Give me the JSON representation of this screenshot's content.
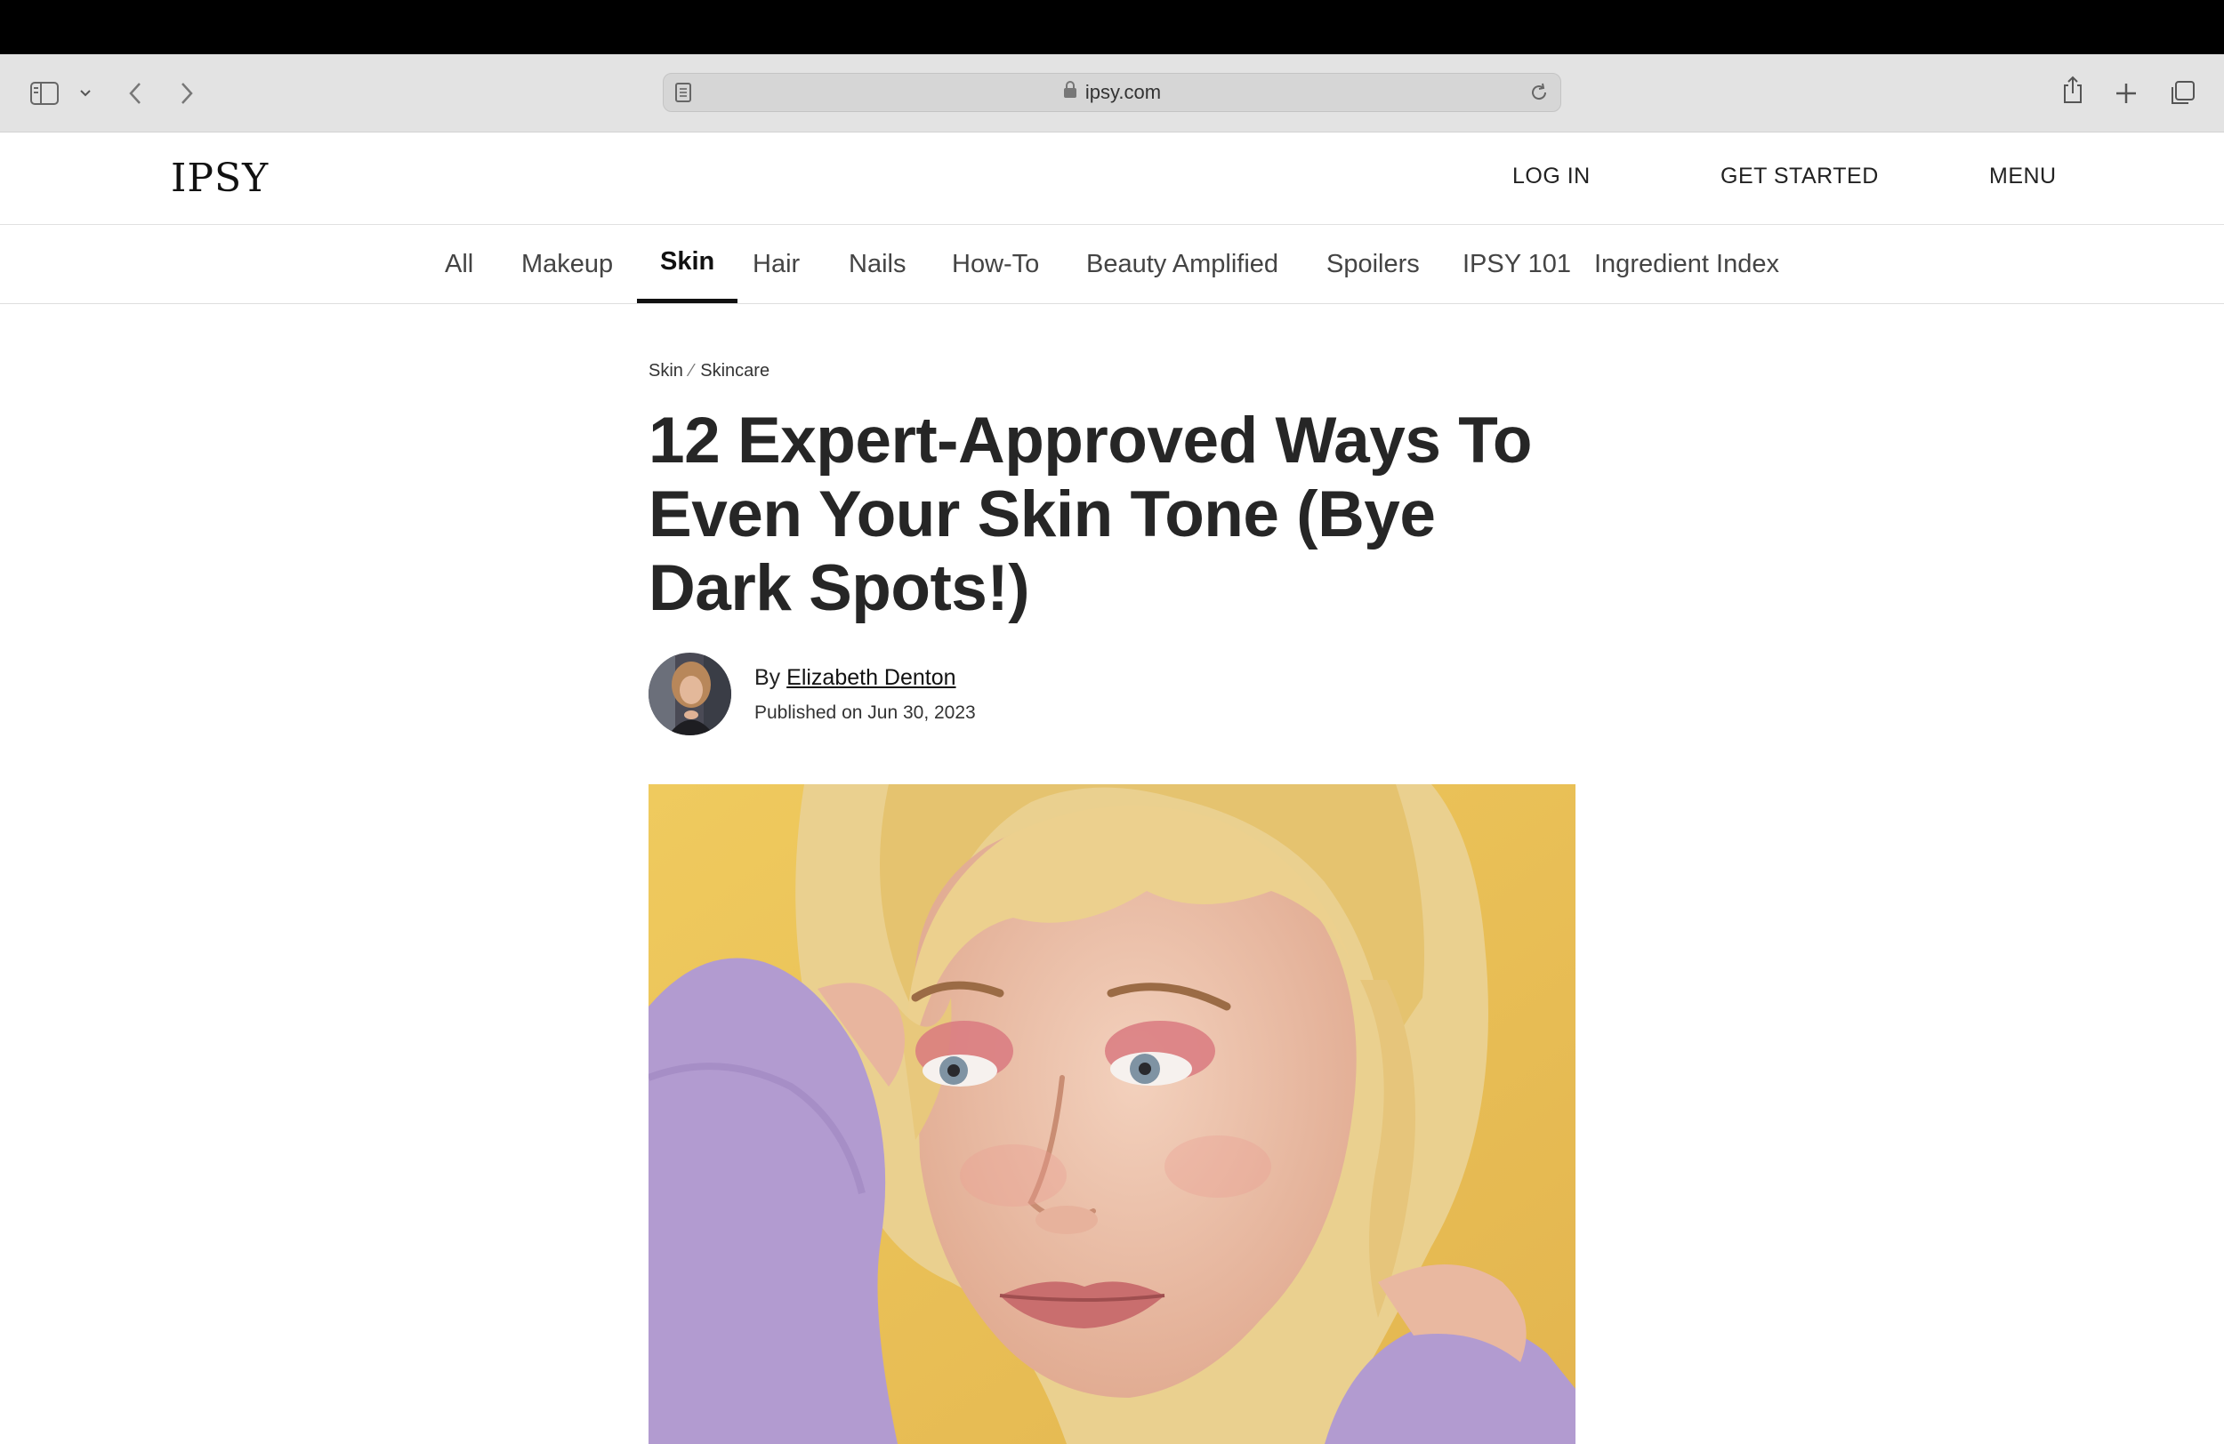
{
  "browser": {
    "url": "ipsy.com",
    "icons": {
      "sidebar": "sidebar-icon",
      "sidebar_menu": "chevron-down-icon",
      "back": "back-arrow-icon",
      "forward": "forward-arrow-icon",
      "reader": "reader-icon",
      "lock": "lock-icon",
      "reload": "reload-icon",
      "share": "share-icon",
      "new_tab": "plus-icon",
      "tabs": "tabs-overview-icon"
    }
  },
  "header": {
    "logo": "IPSY",
    "nav": {
      "login": "LOG IN",
      "get_started": "GET STARTED",
      "menu": "MENU"
    }
  },
  "categories": [
    "All",
    "Makeup",
    "Skin",
    "Hair",
    "Nails",
    "How-To",
    "Beauty Amplified",
    "Spoilers",
    "IPSY 101",
    "Ingredient Index"
  ],
  "active_category": "Skin",
  "article": {
    "breadcrumb": [
      "Skin",
      "Skincare"
    ],
    "title": "12 Expert-Approved Ways To Even Your Skin Tone (Bye Dark Spots!)",
    "by_label": "By",
    "author": "Elizabeth Denton",
    "published": "Published on Jun 30, 2023"
  },
  "colors": {
    "hero_background": "#e7c15a",
    "sweater": "#b29bd0",
    "text": "#262626"
  }
}
